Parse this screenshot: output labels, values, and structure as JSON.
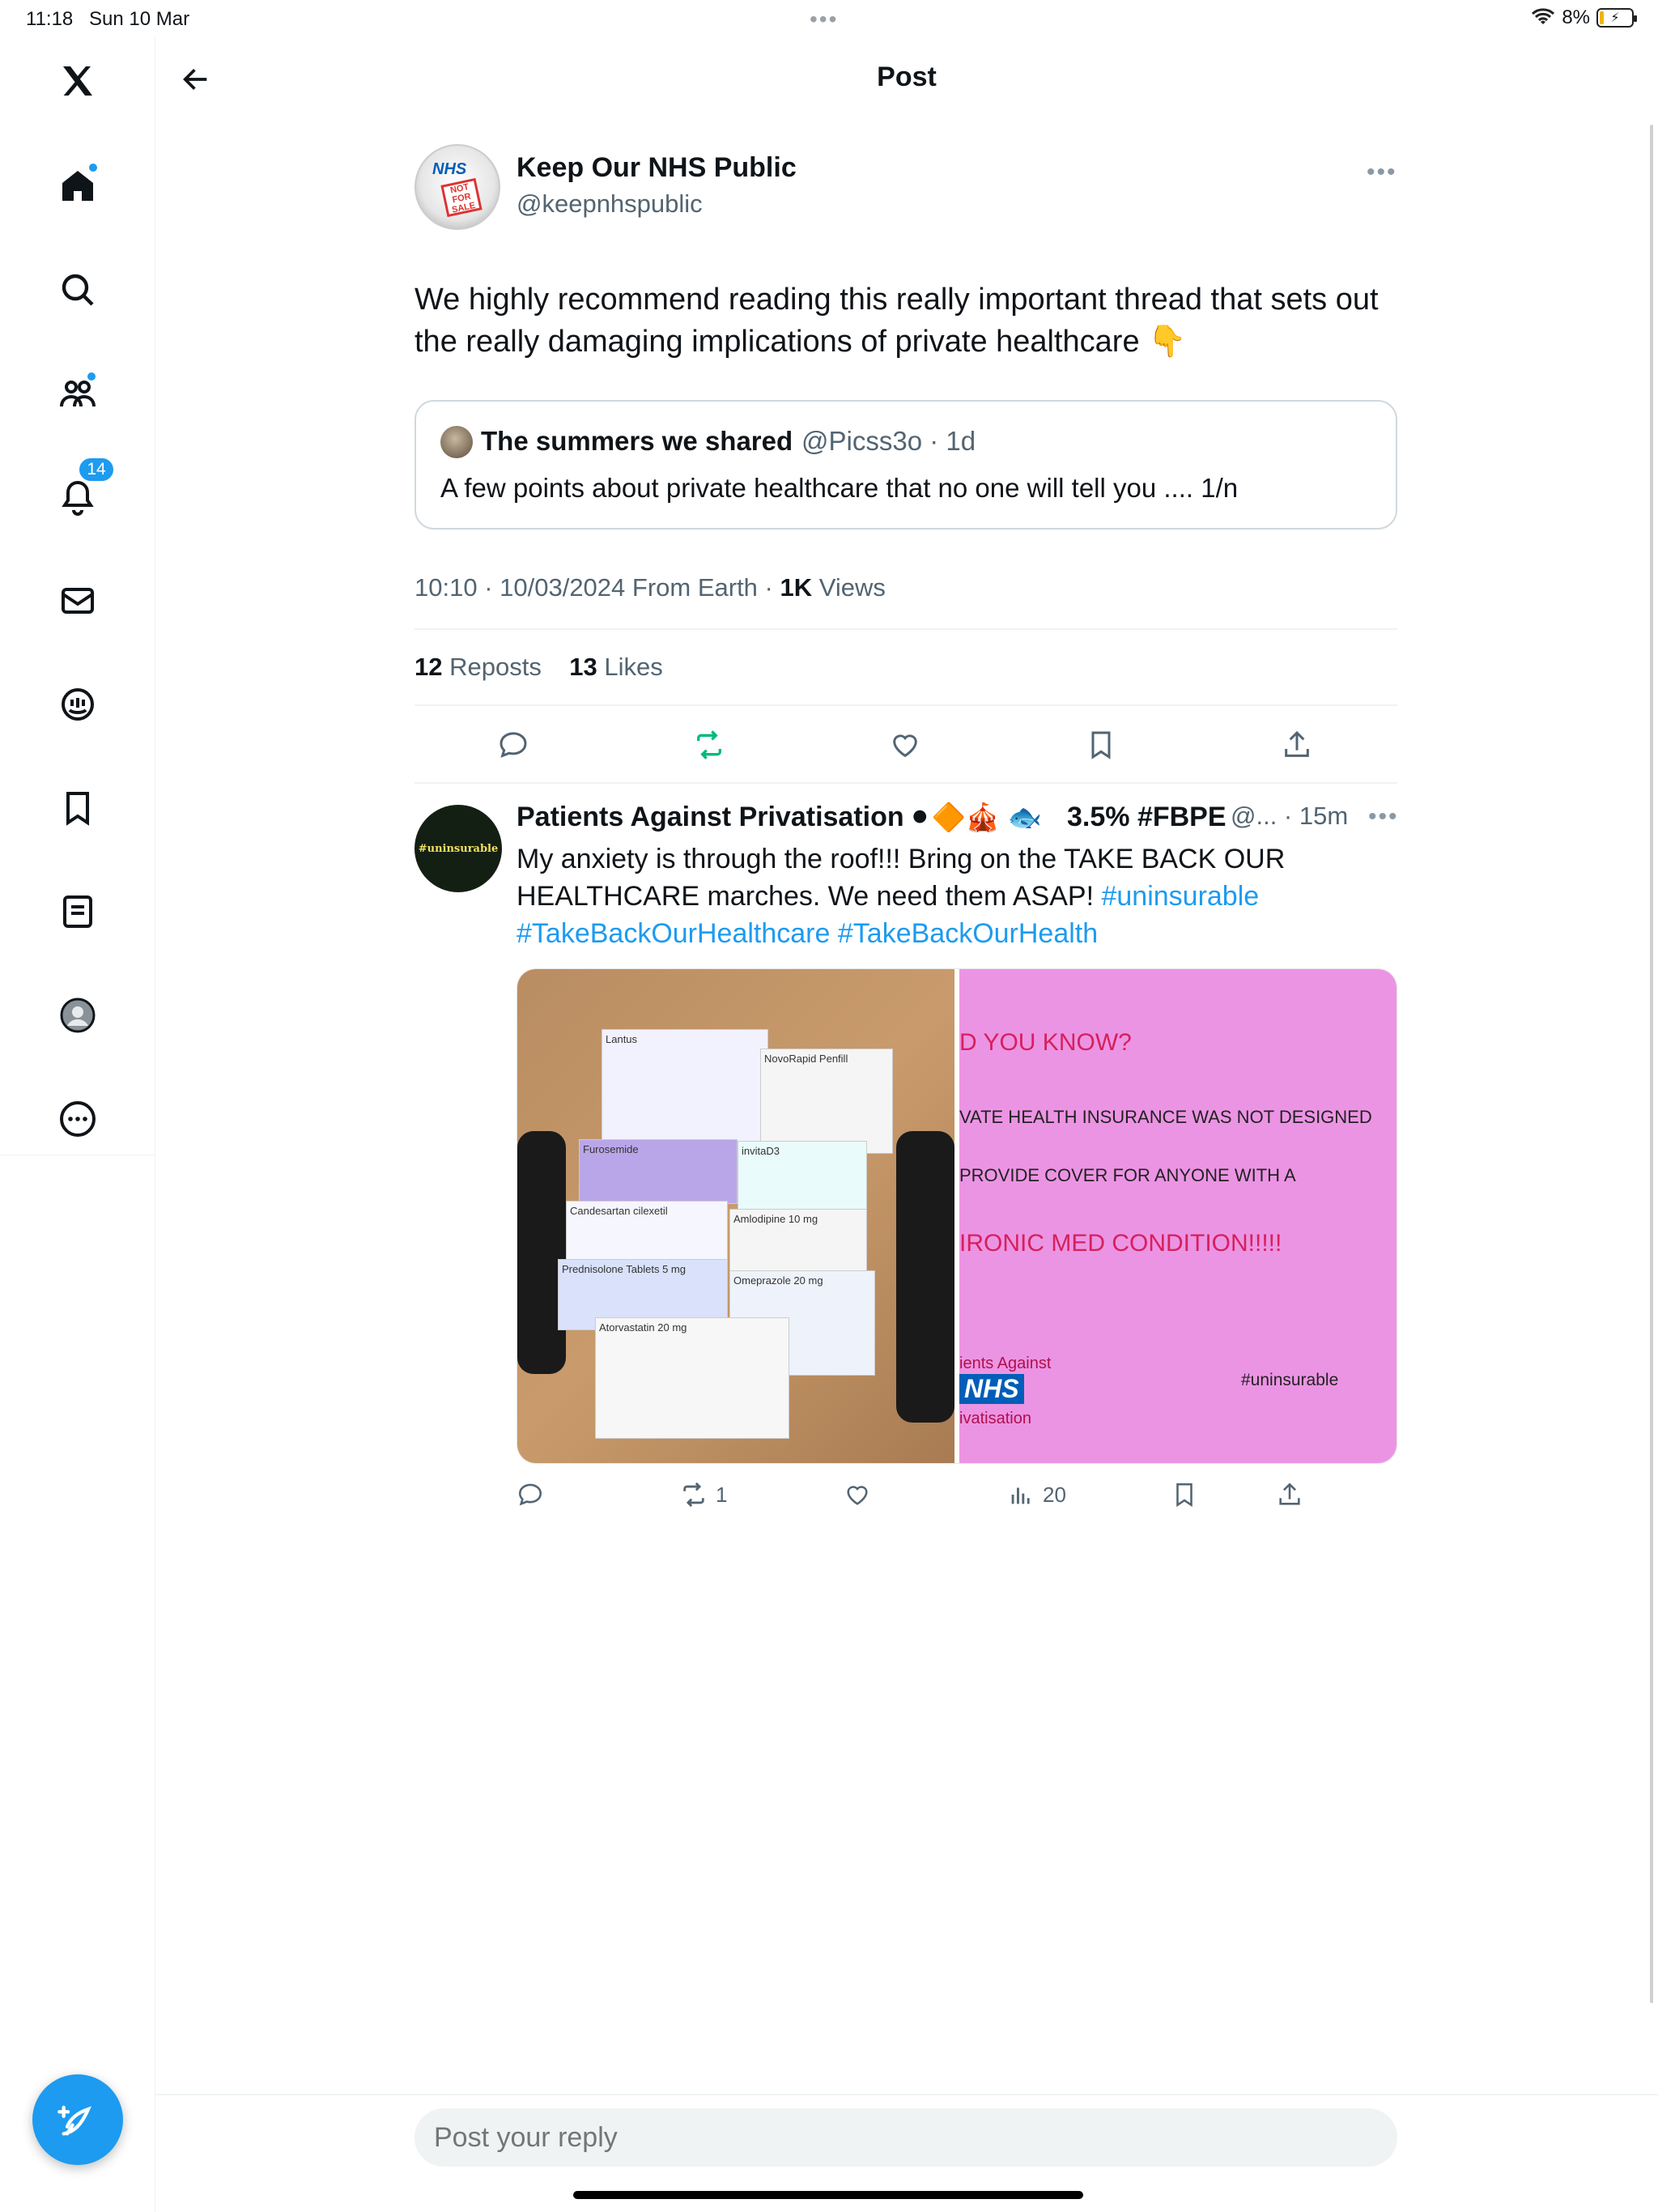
{
  "status_bar": {
    "time": "11:18",
    "date": "Sun 10 Mar",
    "battery": "8%"
  },
  "header": {
    "title": "Post"
  },
  "sidebar": {
    "items": [
      {
        "name": "home"
      },
      {
        "name": "explore"
      },
      {
        "name": "communities"
      },
      {
        "name": "notifications",
        "badge": "14"
      },
      {
        "name": "messages"
      },
      {
        "name": "grok"
      },
      {
        "name": "bookmarks"
      },
      {
        "name": "lists"
      },
      {
        "name": "profile"
      },
      {
        "name": "more"
      }
    ]
  },
  "post": {
    "author_name": "Keep Our NHS Public",
    "author_handle": "@keepnhspublic",
    "avatar_text": "NHS",
    "avatar_stamp": "NOT FOR SALE",
    "text": "We highly recommend reading this really important thread that sets out the really damaging implications of private healthcare 👇",
    "quote": {
      "name": "The summers we shared",
      "handle_time": "@Picss3o · 1d",
      "text": "A few points about private healthcare that no one will tell you .... 1/n"
    },
    "meta": {
      "timestamp": "10:10 · 10/03/2024 From Earth · ",
      "views_count": "1K",
      "views_label": " Views"
    },
    "stats": {
      "reposts_count": "12",
      "reposts_label": " Reposts",
      "likes_count": "13",
      "likes_label": " Likes"
    }
  },
  "reply": {
    "avatar_text": "#uninsurable",
    "author_name": "Patients Against Privatisation",
    "emojis": "⚫🔶🎪 🐟",
    "tag": "3.5% #FBPE",
    "handle_time": "@... · 15m",
    "text_plain": "My anxiety is through the roof!!!  Bring on the TAKE BACK OUR HEALTHCARE marches.  We need them ASAP! ",
    "hashtag_1": "#uninsurable",
    "hashtag_2": "#TakeBackOurHealthcare",
    "hashtag_3": "#TakeBackOurHealth",
    "image_left": {
      "labels": [
        "Lantus",
        "NovoRapid Penfill",
        "Furosemide",
        "invitaD3",
        "Candesartan cilexetil",
        "Amlodipine 10 mg",
        "Prednisolone Tablets 5 mg",
        "Omeprazole 20 mg",
        "Atorvastatin 20 mg"
      ]
    },
    "image_right": {
      "line_1": "D YOU KNOW?",
      "line_2": "VATE HEALTH INSURANCE WAS NOT DESIGNED",
      "line_3": "PROVIDE COVER FOR ANYONE WITH A",
      "line_4": "IRONIC MED CONDITION!!!!!",
      "footer_1": "ients Against",
      "footer_nhs": "NHS",
      "footer_2": "ivatisation",
      "tag": "#uninsurable",
      "background": "#ec94e4"
    },
    "actions": {
      "reposts": "1",
      "views": "20"
    }
  },
  "reply_bar": {
    "placeholder": "Post your reply"
  },
  "colors": {
    "accent": "#1d9bf0",
    "repost_green": "#00ba7c",
    "text_secondary": "#536471"
  }
}
